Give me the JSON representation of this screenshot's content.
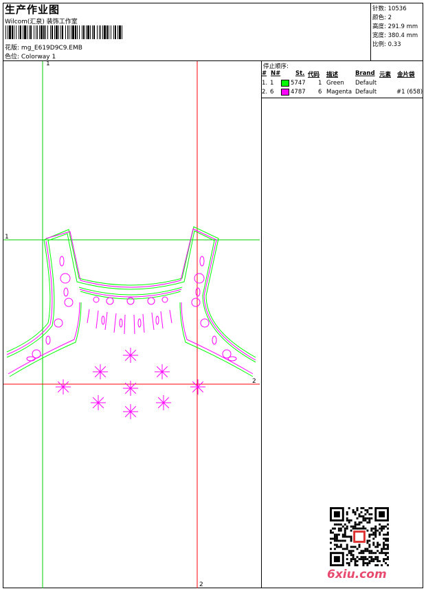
{
  "header": {
    "title": "生产作业图",
    "subtitle": "Wilcom(汇泉) 装饰工作室",
    "design_label": "花版:",
    "design_value": "mg_E619D9C9.EMB",
    "colorway_label": "色位:",
    "colorway_value": "Colorway 1"
  },
  "info": {
    "stitches": "针数: 10536",
    "colors": "颜色: 2",
    "height": "高度: 291.9 mm",
    "width": "宽度: 380.4 mm",
    "scale": "比例: 0.33"
  },
  "stop_sequence": {
    "title": "停止顺序:",
    "headers": {
      "num": "#",
      "n": "N#",
      "st": "St.",
      "code": "代码",
      "desc": "描述",
      "brand": "Brand",
      "element": "元素",
      "sequin": "金片袋"
    },
    "rows": [
      {
        "num": "1.",
        "n": "1",
        "swatch": "#00ff00",
        "st": "5747",
        "code": "1",
        "desc": "Green",
        "brand": "Default",
        "sequin": ""
      },
      {
        "num": "2.",
        "n": "6",
        "swatch": "#ff00ff",
        "st": "4787",
        "code": "6",
        "desc": "Magenta",
        "brand": "Default",
        "sequin": "#1 (658)"
      }
    ]
  },
  "guides": {
    "g1_top": "1",
    "g1_left": "1",
    "g2_right": "2",
    "g2_bottom": "2"
  },
  "colors": {
    "green": "#00ff00",
    "magenta": "#ff00ff",
    "red": "#ff0000",
    "guide_green": "#00cc00"
  },
  "watermark": {
    "text": "6xiu.com"
  }
}
